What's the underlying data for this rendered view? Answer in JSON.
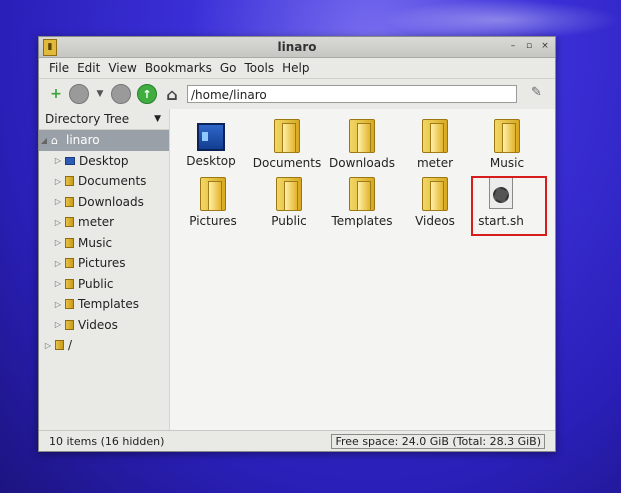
{
  "window": {
    "title": "linaro"
  },
  "menu": [
    "File",
    "Edit",
    "View",
    "Bookmarks",
    "Go",
    "Tools",
    "Help"
  ],
  "toolbar": {
    "path": "/home/linaro"
  },
  "sidebar": {
    "header": "Directory Tree",
    "root": "linaro",
    "items": [
      "Desktop",
      "Documents",
      "Downloads",
      "meter",
      "Music",
      "Pictures",
      "Public",
      "Templates",
      "Videos"
    ],
    "filesystem_root": "/"
  },
  "files": [
    {
      "name": "Desktop",
      "icon": "desktop-icon"
    },
    {
      "name": "Documents",
      "icon": "folder-icon"
    },
    {
      "name": "Downloads",
      "icon": "folder-icon"
    },
    {
      "name": "meter",
      "icon": "folder-icon"
    },
    {
      "name": "Music",
      "icon": "folder-icon"
    },
    {
      "name": "Pictures",
      "icon": "folder-icon"
    },
    {
      "name": "Public",
      "icon": "folder-icon"
    },
    {
      "name": "Templates",
      "icon": "folder-icon"
    },
    {
      "name": "Videos",
      "icon": "folder-icon"
    },
    {
      "name": "start.sh",
      "icon": "script-icon"
    }
  ],
  "status": {
    "items": "10 items (16 hidden)",
    "free_space": "Free space: 24.0 GiB (Total: 28.3 GiB)"
  },
  "colors": {
    "highlight": "#d81b1b",
    "background": "#2a1fb8"
  }
}
